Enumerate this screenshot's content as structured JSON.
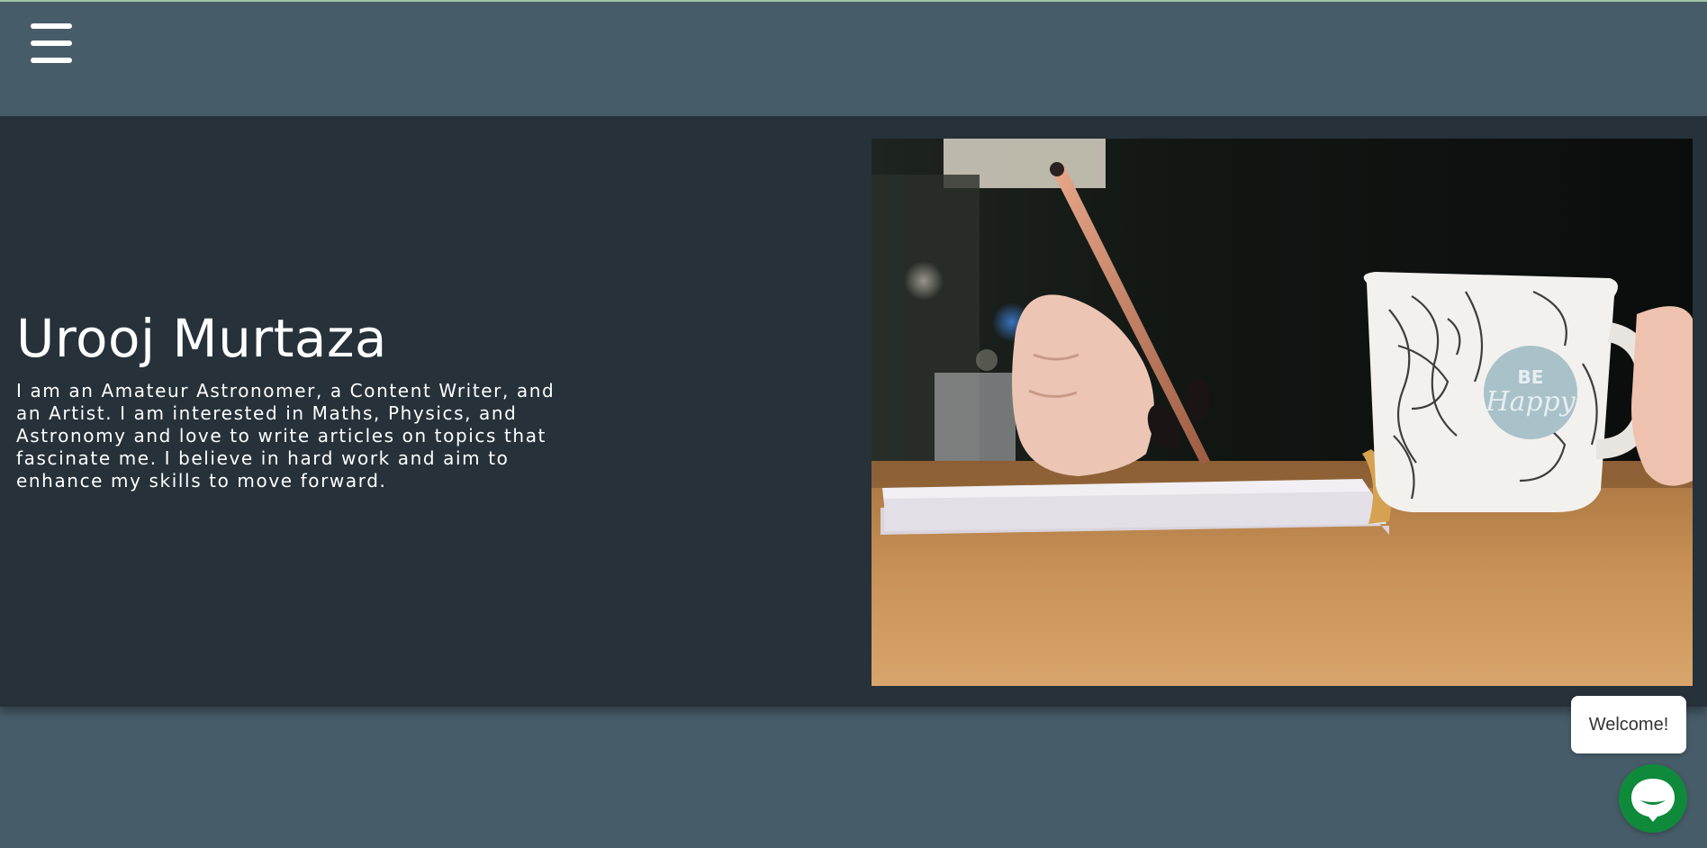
{
  "header": {
    "menu_icon": "hamburger-menu-icon"
  },
  "hero": {
    "title": "Urooj Murtaza",
    "bio": "I am an Amateur Astronomer, a Content Writer, and an Artist. I am interested in Maths, Physics, and Astronomy and love to write articles on topics that fascinate me. I believe in hard work and aim to enhance my skills to move forward.",
    "image_content": "hand-writing-in-notebook-with-be-happy-mug",
    "image_mug_text": [
      "BE",
      "Happy"
    ]
  },
  "chat": {
    "welcome_text": "Welcome!",
    "icon": "chat-bubble-icon",
    "accent_color": "#0f8a3b"
  },
  "colors": {
    "page_background": "#475c69",
    "hero_background": "#263139",
    "text": "#ffffff"
  }
}
